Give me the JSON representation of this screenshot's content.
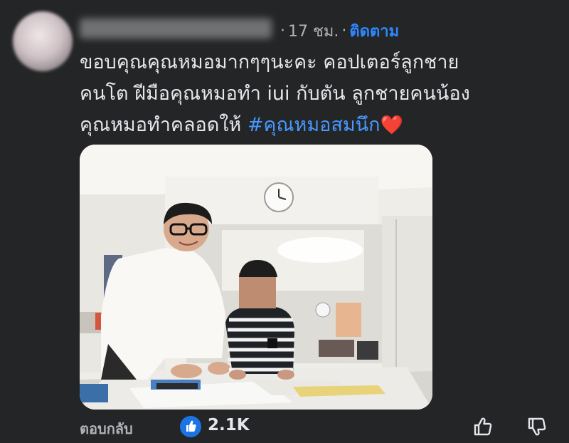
{
  "comment": {
    "author": "",
    "time": "17 ชม.",
    "separator": "·",
    "follow_label": "ติดตาม",
    "text_line1": "ขอบคุณคุณหมอมากๆๆนะคะ คอปเตอร์ลูกชาย",
    "text_line2": "คนโต ฝีมือคุณหมอทำ iui กับตัน ลูกชายคนน้อง",
    "text_line3": "คุณหมอทำคลอดให้ ",
    "hashtag": "#คุณหมอสมนึก",
    "heart": "❤️"
  },
  "footer": {
    "reply_label": "ตอบกลับ",
    "like_count": "2.1K"
  },
  "icons": {
    "reaction": "like-icon",
    "thumbs_up": "thumbs-up-icon",
    "thumbs_down": "thumbs-down-icon"
  },
  "colors": {
    "background": "#242526",
    "text": "#e4e6eb",
    "muted": "#b0b3b8",
    "link": "#2d88ff",
    "like_blue": "#1b74e4"
  }
}
